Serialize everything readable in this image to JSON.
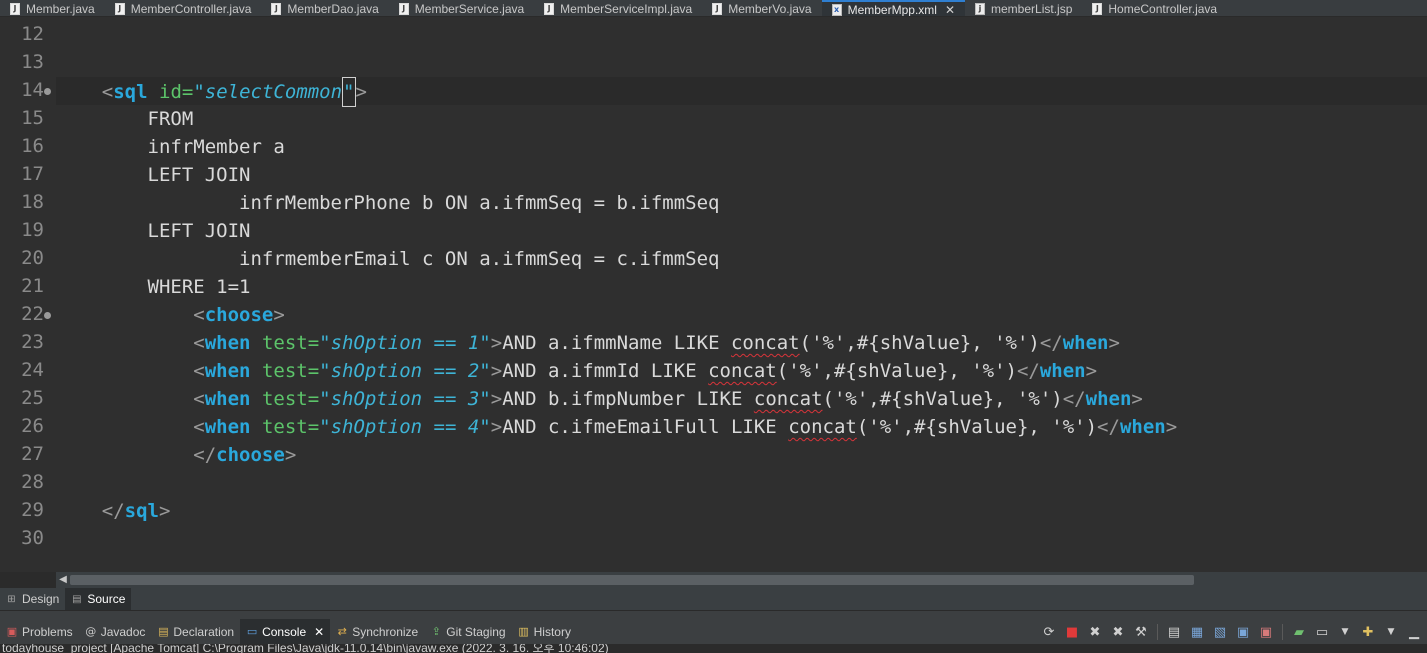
{
  "editor_tabs": [
    {
      "label": "Member.java",
      "icon": "java-file-icon"
    },
    {
      "label": "MemberController.java",
      "icon": "java-file-icon"
    },
    {
      "label": "MemberDao.java",
      "icon": "java-file-icon"
    },
    {
      "label": "MemberService.java",
      "icon": "java-file-icon"
    },
    {
      "label": "MemberServiceImpl.java",
      "icon": "java-file-icon"
    },
    {
      "label": "MemberVo.java",
      "icon": "java-file-icon"
    },
    {
      "label": "MemberMpp.xml",
      "icon": "xml-file-icon",
      "active": true
    },
    {
      "label": "memberList.jsp",
      "icon": "jsp-file-icon"
    },
    {
      "label": "HomeController.java",
      "icon": "java-file-icon"
    }
  ],
  "code": {
    "lines": [
      {
        "no": "12",
        "text": ""
      },
      {
        "no": "13",
        "text": ""
      },
      {
        "no": "14",
        "text": "    <sql id=\"selectCommon\">",
        "fold": true,
        "current": true
      },
      {
        "no": "15",
        "text": "        FROM"
      },
      {
        "no": "16",
        "text": "        infrMember a"
      },
      {
        "no": "17",
        "text": "        LEFT JOIN"
      },
      {
        "no": "18",
        "text": "                infrMemberPhone b ON a.ifmmSeq = b.ifmmSeq"
      },
      {
        "no": "19",
        "text": "        LEFT JOIN"
      },
      {
        "no": "20",
        "text": "                infrmemberEmail c ON a.ifmmSeq = c.ifmmSeq"
      },
      {
        "no": "21",
        "text": "        WHERE 1=1"
      },
      {
        "no": "22",
        "text": "            <choose>",
        "fold": true
      },
      {
        "no": "23",
        "text": "            <when test=\"shOption == 1\">AND a.ifmmName LIKE concat('%',#{shValue}, '%')</when>"
      },
      {
        "no": "24",
        "text": "            <when test=\"shOption == 2\">AND a.ifmmId LIKE concat('%',#{shValue}, '%')</when>"
      },
      {
        "no": "25",
        "text": "            <when test=\"shOption == 3\">AND b.ifmpNumber LIKE concat('%',#{shValue}, '%')</when>"
      },
      {
        "no": "26",
        "text": "            <when test=\"shOption == 4\">AND c.ifmeEmailFull LIKE concat('%',#{shValue}, '%')</when>"
      },
      {
        "no": "27",
        "text": "            </choose>"
      },
      {
        "no": "28",
        "text": ""
      },
      {
        "no": "29",
        "text": "    </sql>"
      },
      {
        "no": "30",
        "text": ""
      }
    ]
  },
  "mode_tabs": [
    {
      "label": "Design",
      "icon": "design-icon"
    },
    {
      "label": "Source",
      "icon": "source-icon",
      "active": true
    }
  ],
  "view_tabs": [
    {
      "label": "Problems",
      "icon": "problems-icon"
    },
    {
      "label": "Javadoc",
      "icon": "javadoc-icon"
    },
    {
      "label": "Declaration",
      "icon": "declaration-icon"
    },
    {
      "label": "Console",
      "icon": "console-icon",
      "active": true
    },
    {
      "label": "Synchronize",
      "icon": "synchronize-icon"
    },
    {
      "label": "Git Staging",
      "icon": "git-staging-icon"
    },
    {
      "label": "History",
      "icon": "history-icon"
    }
  ],
  "console_status": "todayhouse_project [Apache Tomcat] C:\\Program Files\\Java\\jdk-11.0.14\\bin\\javaw.exe  (2022. 3. 16. 오후 10:46:02)",
  "colors": {
    "keyword": "#2aa8dc",
    "attribute": "#5cc46a",
    "string": "#3eb4d6",
    "tag_bracket": "#9a9a9a",
    "text": "#d9d9d9",
    "background": "#2f2f2f",
    "active_tab_accent": "#2f7fd1"
  }
}
